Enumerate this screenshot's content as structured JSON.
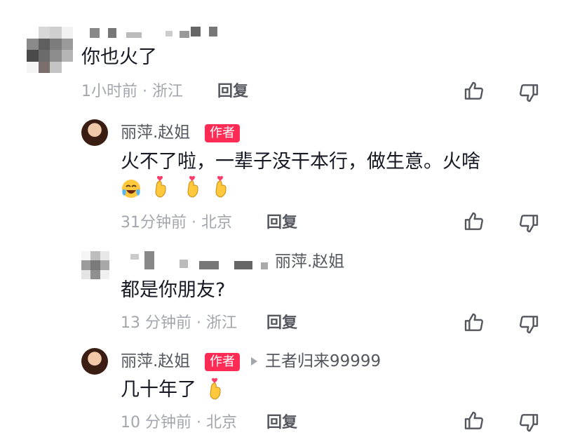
{
  "comments": [
    {
      "text": "你也火了",
      "time_location": "1小时前 · 浙江",
      "reply_label": "回复"
    },
    {
      "author": "丽萍.赵姐",
      "author_badge": "作者",
      "text": "火不了啦，一辈子没干本行，做生意。火啥",
      "time_location": "31分钟前 · 北京",
      "reply_label": "回复",
      "emojis": [
        "laughing-crying-emoji",
        "finger-heart-emoji",
        "finger-heart-emoji",
        "finger-heart-emoji"
      ]
    },
    {
      "reply_to": "丽萍.赵姐",
      "text": "都是你朋友?",
      "time_location": "13 分钟前 · 浙江",
      "reply_label": "回复"
    },
    {
      "author": "丽萍.赵姐",
      "author_badge": "作者",
      "reply_to": "王者归来99999",
      "text": "几十年了",
      "time_location": "10 分钟前 · 北京",
      "reply_label": "回复",
      "emojis": [
        "finger-heart-emoji"
      ]
    }
  ],
  "colors": {
    "primary_text": "#161823",
    "secondary_text": "#a4a6ad",
    "name_text": "#55575f",
    "author_badge": "#fe2c55"
  },
  "icons": [
    "thumbs-up-icon",
    "thumbs-down-icon",
    "reply-arrow-icon"
  ]
}
